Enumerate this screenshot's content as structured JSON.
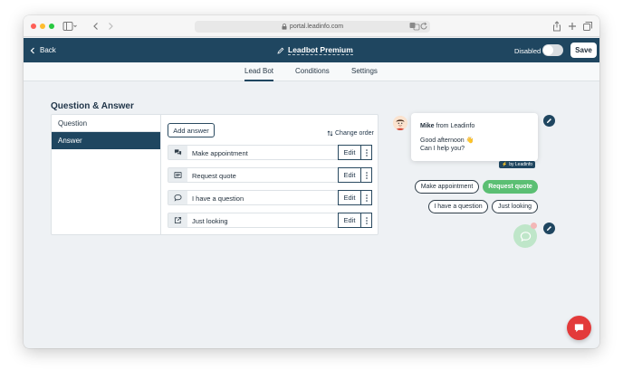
{
  "browser": {
    "url": "portal.leadinfo.com"
  },
  "header": {
    "back_label": "Back",
    "title": "Leadbot Premium",
    "status_label": "Disabled",
    "toggle_on": false,
    "save_label": "Save",
    "accent_color": "#1f4660"
  },
  "tabs": [
    {
      "label": "Lead Bot",
      "active": true
    },
    {
      "label": "Conditions",
      "active": false
    },
    {
      "label": "Settings",
      "active": false
    }
  ],
  "section": {
    "title": "Question & Answer",
    "menu": [
      {
        "label": "Question",
        "active": false
      },
      {
        "label": "Answer",
        "active": true
      }
    ],
    "add_answer_label": "Add answer",
    "change_order_label": "Change order",
    "edit_label": "Edit",
    "answers": [
      {
        "label": "Make appointment",
        "icon": "chat-bubbles-icon"
      },
      {
        "label": "Request quote",
        "icon": "form-list-icon"
      },
      {
        "label": "I have a question",
        "icon": "speech-bubble-icon"
      },
      {
        "label": "Just looking",
        "icon": "external-link-icon"
      }
    ]
  },
  "preview": {
    "agent_name": "Mike",
    "agent_suffix": "from Leadinfo",
    "message_line1": "Good afternoon 👋",
    "message_line2": "Can I help you?",
    "badge": "by Leadinfo",
    "options": [
      {
        "label": "Make appointment",
        "highlight": false
      },
      {
        "label": "Request quote",
        "highlight": true
      },
      {
        "label": "I have a question",
        "highlight": false
      },
      {
        "label": "Just looking",
        "highlight": false
      }
    ],
    "highlight_color": "#5bbf73"
  }
}
